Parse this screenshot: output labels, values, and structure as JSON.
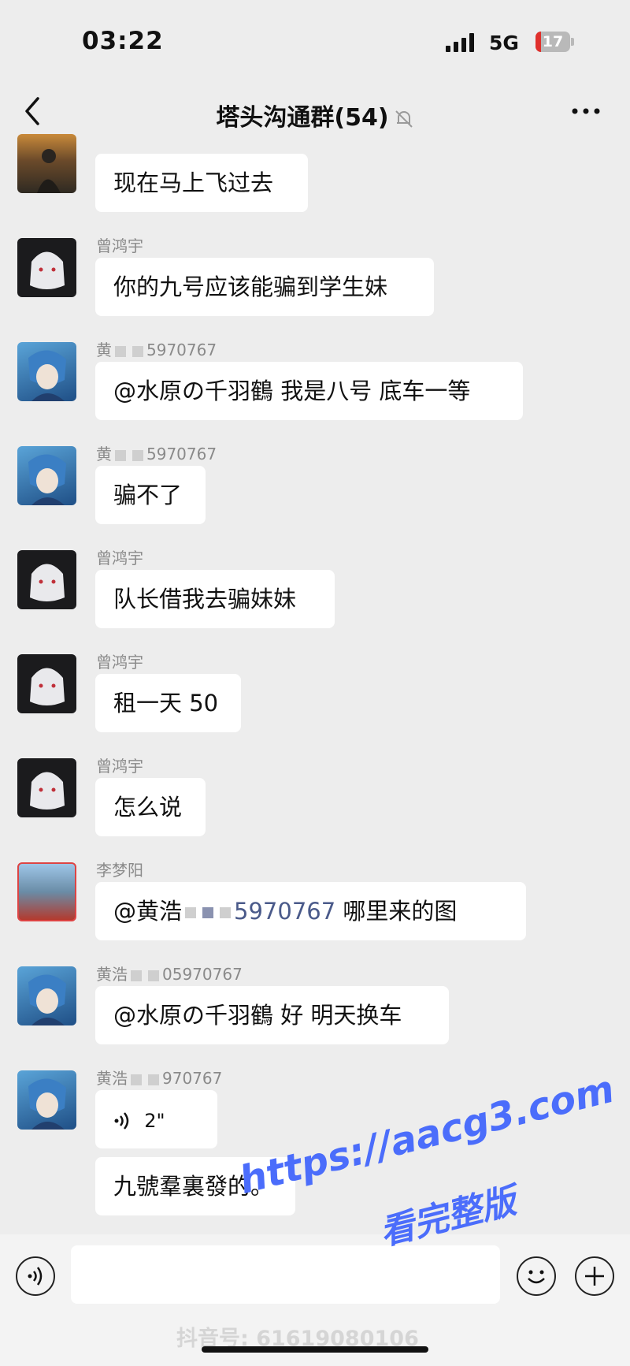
{
  "status_bar": {
    "time": "03:22",
    "network": "5G",
    "battery": "17",
    "battery_level": 0.17,
    "battery_color": "#e0302c"
  },
  "header": {
    "title": "塔头沟通群(54)"
  },
  "messages": [
    {
      "sender": "",
      "text": "现在马上飞过去"
    },
    {
      "sender": "曾鸿宇",
      "text": "你的九号应该能骗到学生妹"
    },
    {
      "sender_prefix": "黄",
      "sender_suffix": "5970767",
      "text": "@水原の千羽鶴 我是八号 底车一等"
    },
    {
      "sender_prefix": "黄",
      "sender_suffix": "5970767",
      "text": "骗不了"
    },
    {
      "sender": "曾鸿宇",
      "text": "队长借我去骗妹妹"
    },
    {
      "sender": "曾鸿宇",
      "text": "租一天 50"
    },
    {
      "sender": "曾鸿宇",
      "text": "怎么说"
    },
    {
      "sender": "李梦阳",
      "text_prefix": "@黄浩",
      "text_mention": "5970767",
      "text_suffix": "哪里来的图"
    },
    {
      "sender_prefix": "黄浩",
      "sender_suffix": "05970767",
      "text": "@水原の千羽鶴 好 明天换车"
    },
    {
      "sender_prefix": "黄浩",
      "sender_suffix": "970767",
      "voice_duration": "2\""
    },
    {
      "text": "九號羣裏發的。"
    }
  ],
  "watermark": {
    "url": "https://aacg3.com",
    "subtitle": "看完整版",
    "douyin_id": "抖音号: 61619080106"
  },
  "colors": {
    "background": "#ededed",
    "bubble": "#ffffff",
    "watermark": "#4b6dfb",
    "mention": "#4a5a8a"
  },
  "icons": {
    "back": "chevron-left-icon",
    "mute": "bell-off-icon",
    "more": "more-dots-icon",
    "voice": "voice-icon",
    "emoji": "smile-icon",
    "plus": "plus-icon"
  }
}
